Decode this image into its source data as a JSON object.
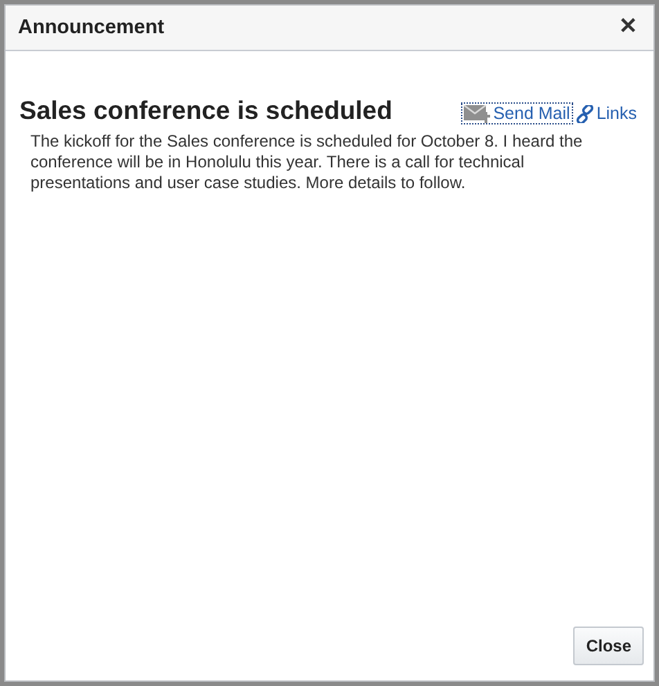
{
  "dialog": {
    "title": "Announcement",
    "close_icon": "✕"
  },
  "announcement": {
    "heading": "Sales conference is scheduled",
    "body": "The kickoff for the Sales conference is scheduled for October 8. I heard the conference will be in Honolulu this year. There is a call for technical presentations and user case studies. More details to follow."
  },
  "actions": [
    {
      "kind": "mail",
      "label": "Send Mail",
      "focused": true
    },
    {
      "kind": "link",
      "label": "Links",
      "focused": false
    }
  ],
  "buttons": [
    "Close"
  ]
}
